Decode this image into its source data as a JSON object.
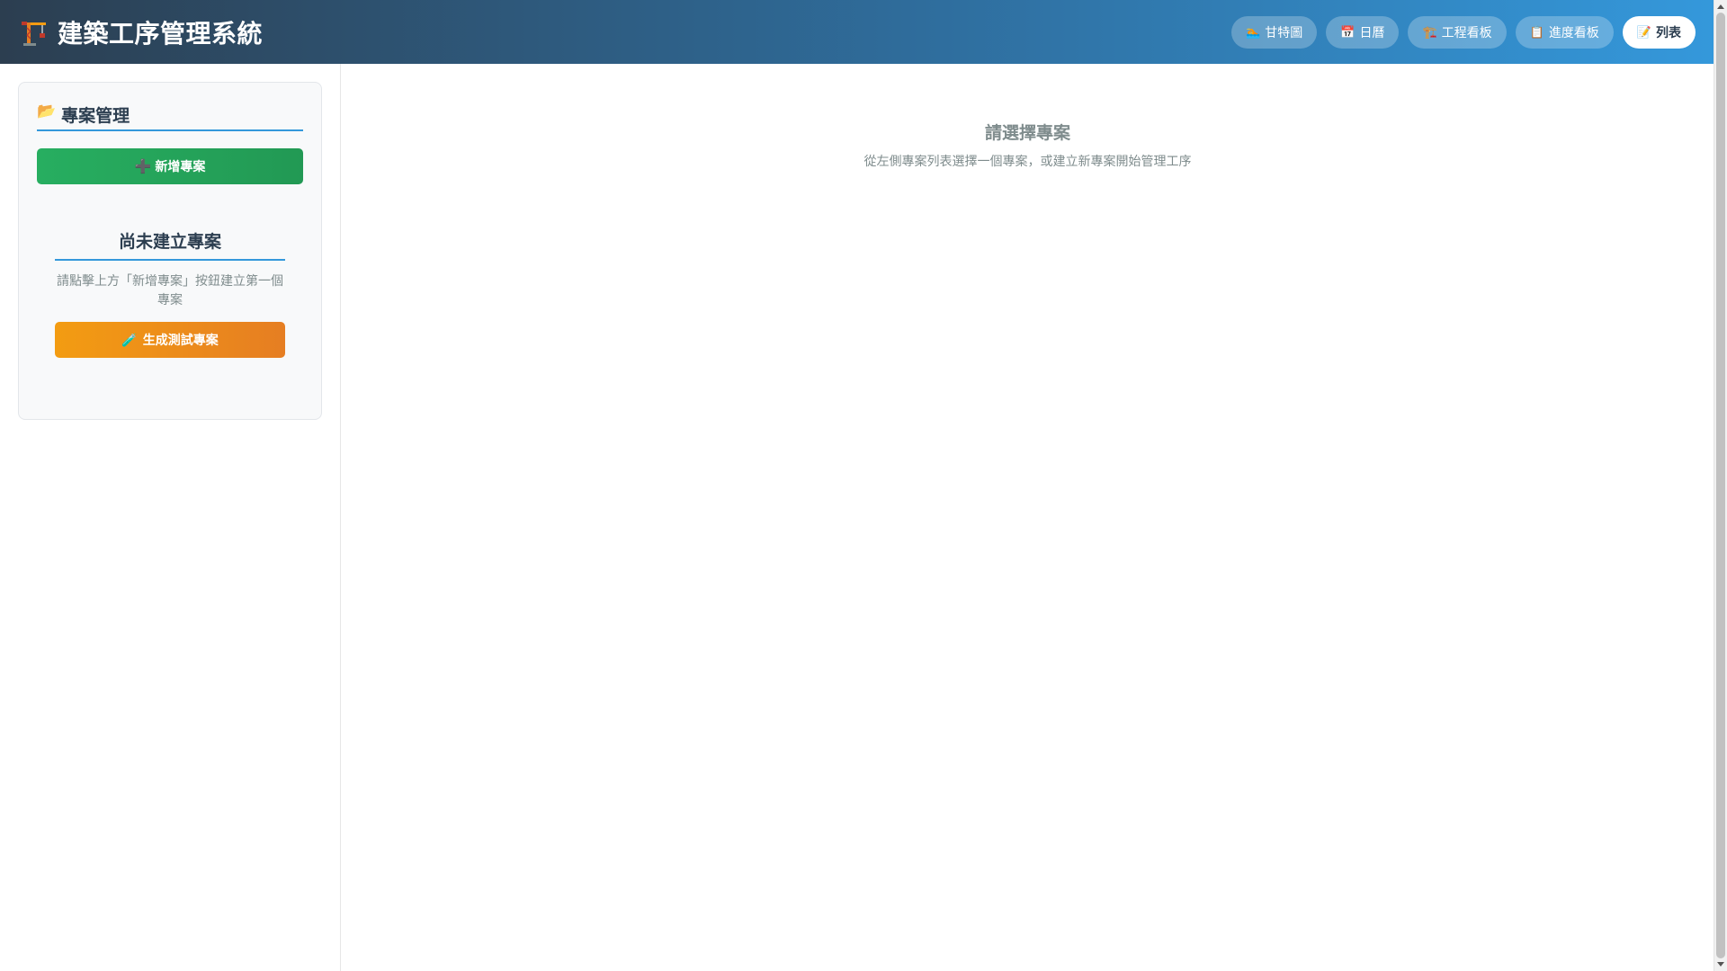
{
  "header": {
    "title": "建築工序管理系統",
    "brand_icon": "crane-icon",
    "nav": [
      {
        "label": "甘特圖",
        "icon": "🏊",
        "active": false
      },
      {
        "label": "日曆",
        "icon": "📅",
        "active": false
      },
      {
        "label": "工程看板",
        "icon": "🏗️",
        "active": false
      },
      {
        "label": "進度看板",
        "icon": "📋",
        "active": false
      },
      {
        "label": "列表",
        "icon": "📝",
        "active": true
      }
    ]
  },
  "sidebar": {
    "panel_icon": "📂",
    "panel_title": "專案管理",
    "new_project_icon": "➕",
    "new_project_label": "新增專案",
    "empty_title": "尚未建立專案",
    "empty_desc": "請點擊上方「新增專案」按鈕建立第一個專案",
    "test_project_icon": "🧪",
    "test_project_label": "生成測試專案"
  },
  "main": {
    "title": "請選擇專案",
    "desc": "從左側專案列表選擇一個專案，或建立新專案開始管理工序"
  },
  "colors": {
    "header_start": "#2c3e50",
    "header_end": "#3498db",
    "accent": "#3498db",
    "success": "#27ae60",
    "warning": "#f39c12"
  }
}
